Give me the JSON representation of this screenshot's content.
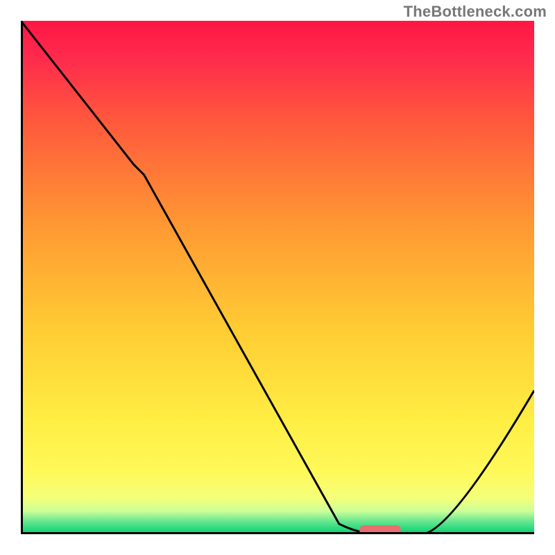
{
  "attribution": "TheBottleneck.com",
  "chart_data": {
    "type": "line",
    "title": "",
    "xlabel": "",
    "ylabel": "",
    "xlim": [
      0,
      100
    ],
    "ylim": [
      0,
      100
    ],
    "series": [
      {
        "name": "curve",
        "x": [
          0,
          22,
          24,
          62,
          70,
          78,
          100
        ],
        "y": [
          100,
          72,
          70,
          2,
          0,
          0,
          28
        ]
      }
    ],
    "marker": {
      "x": 70,
      "y": 0,
      "width": 8,
      "height": 2,
      "color": "#e76f6f"
    },
    "gradient_stops": [
      {
        "offset": 0.0,
        "color": "#ff1744"
      },
      {
        "offset": 0.07,
        "color": "#ff2a4d"
      },
      {
        "offset": 0.2,
        "color": "#ff5a3c"
      },
      {
        "offset": 0.4,
        "color": "#ff9933"
      },
      {
        "offset": 0.6,
        "color": "#ffcc33"
      },
      {
        "offset": 0.78,
        "color": "#ffee44"
      },
      {
        "offset": 0.88,
        "color": "#fff95a"
      },
      {
        "offset": 0.93,
        "color": "#f4ff7a"
      },
      {
        "offset": 0.955,
        "color": "#ccff99"
      },
      {
        "offset": 0.975,
        "color": "#66e690"
      },
      {
        "offset": 1.0,
        "color": "#00d070"
      }
    ],
    "axis_color": "#000000",
    "line_color": "#000000"
  }
}
